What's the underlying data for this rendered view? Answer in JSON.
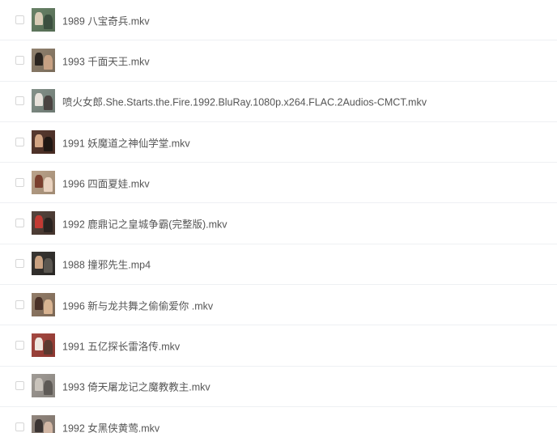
{
  "files": [
    {
      "name": "1989 八宝奇兵.mkv",
      "thumb": {
        "bg": "#5f7a5e",
        "a": "#d8cbb5",
        "b": "#3b4f3f"
      }
    },
    {
      "name": "1993 千面天王.mkv",
      "thumb": {
        "bg": "#8a7a66",
        "a": "#2b2520",
        "b": "#c7a183"
      }
    },
    {
      "name": "喷火女郎.She.Starts.the.Fire.1992.BluRay.1080p.x264.FLAC.2Audios-CMCT.mkv",
      "thumb": {
        "bg": "#7c8a82",
        "a": "#e7e1da",
        "b": "#4a4341"
      }
    },
    {
      "name": "1991 妖魔道之神仙学堂.mkv",
      "thumb": {
        "bg": "#4e2f25",
        "a": "#d2a584",
        "b": "#1f1713"
      }
    },
    {
      "name": "1996 四面夏娃.mkv",
      "thumb": {
        "bg": "#b69d83",
        "a": "#7a3f2e",
        "b": "#e9d2bf"
      }
    },
    {
      "name": "1992 鹿鼎记之皇城争霸(完整版).mkv",
      "thumb": {
        "bg": "#4c3a32",
        "a": "#c33a33",
        "b": "#2a2320"
      }
    },
    {
      "name": "1988 撞邪先生.mp4",
      "thumb": {
        "bg": "#2e2b28",
        "a": "#c9a181",
        "b": "#5a5650"
      }
    },
    {
      "name": "1996 新与龙共舞之偷偷爱你 .mkv",
      "thumb": {
        "bg": "#8c7560",
        "a": "#4a3128",
        "b": "#d8b391"
      }
    },
    {
      "name": "1991 五亿探长雷洛传.mkv",
      "thumb": {
        "bg": "#9f3e36",
        "a": "#efe6de",
        "b": "#5b3a30"
      }
    },
    {
      "name": "1993 倚天屠龙记之魔教教主.mkv",
      "thumb": {
        "bg": "#9a958f",
        "a": "#c9c3bb",
        "b": "#5e5a56"
      }
    },
    {
      "name": "1992 女黑侠黄莺.mkv",
      "thumb": {
        "bg": "#8b7f76",
        "a": "#3b3433",
        "b": "#d2b7a5"
      }
    }
  ]
}
